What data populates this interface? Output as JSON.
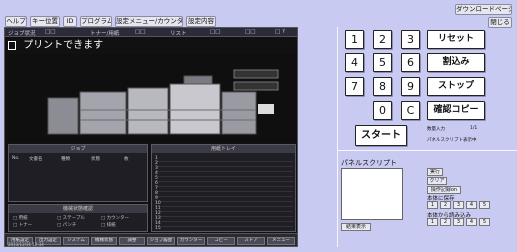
{
  "toolbar": {
    "tabs": [
      "ヘルプ",
      "キー位置",
      "ID",
      "プログラム",
      "設定メニュー/カウンター",
      "設定内容"
    ],
    "download_page": "ダウンロードページ",
    "close": "閉じる"
  },
  "screen": {
    "status_items": [
      "ジョブ状況",
      "□□",
      "トナー/用紙",
      "□□",
      "リスト",
      "□□",
      "□□",
      "□ ?"
    ],
    "message": "プリントできます",
    "left_panel_title": "ジョブ",
    "left_panel_cols": [
      "No.",
      "文書名",
      "種類",
      "状態",
      "枚"
    ],
    "info_panel_title": "機械状態確認",
    "info_lines": [
      "□ 用紙",
      "□ トナー",
      "□ ステープル",
      "□ パンチ",
      "□ カウンター",
      "□ 排紙"
    ],
    "right_panel_title": "用紙トレイ",
    "tray_rows": [
      "1",
      "2",
      "3",
      "4",
      "5",
      "6",
      "7",
      "8",
      "9",
      "10",
      "11",
      "12",
      "13",
      "14",
      "15"
    ],
    "bottom_buttons": [
      "用紙設定",
      "出力設定",
      "システム",
      "機械状態",
      "調整",
      "ジョブ履歴",
      "カウンター",
      "コピー",
      "ストア",
      "メニュー"
    ],
    "footer_left": "2013/12/31 12:34"
  },
  "keypad": {
    "keys": [
      "1",
      "2",
      "3",
      "4",
      "5",
      "6",
      "7",
      "8",
      "9",
      "0",
      "C"
    ],
    "reset": "リセット",
    "interrupt": "割込み",
    "stop": "ストップ",
    "proof_copy": "確認コピー",
    "start": "スタート"
  },
  "side_info": {
    "label1": "数量入力",
    "label2": "1/1",
    "hint": "パネルスクリプト表示中"
  },
  "script": {
    "title": "パネルスクリプト",
    "result_button": "結果表示",
    "run": "実行",
    "clear": "クリア",
    "record": "操作記録on",
    "save_title": "本体に保存",
    "save_slots": [
      "1",
      "2",
      "3",
      "4",
      "5"
    ],
    "load_title": "本体から読み込み",
    "load_slots": [
      "1",
      "2",
      "3",
      "4",
      "5"
    ]
  },
  "colors": {
    "background": "#c9caf1",
    "screen": "#111111",
    "panel": "#1e1e24"
  }
}
